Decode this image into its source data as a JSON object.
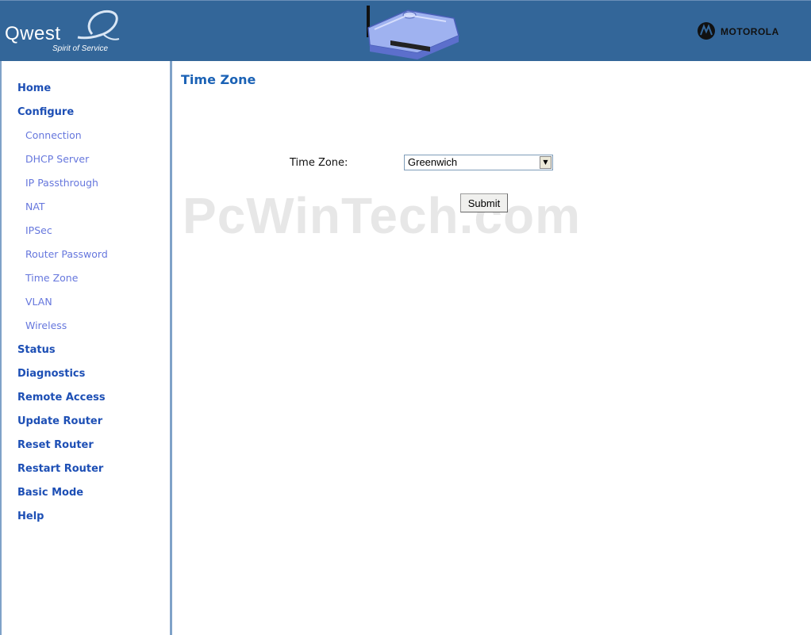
{
  "header": {
    "brand": "Qwest",
    "tagline": "Spirit of Service",
    "vendor": "MOTOROLA"
  },
  "sidebar": {
    "items": [
      {
        "label": "Home",
        "level": "main"
      },
      {
        "label": "Configure",
        "level": "main"
      },
      {
        "label": "Connection",
        "level": "sub"
      },
      {
        "label": "DHCP Server",
        "level": "sub"
      },
      {
        "label": "IP Passthrough",
        "level": "sub"
      },
      {
        "label": "NAT",
        "level": "sub"
      },
      {
        "label": "IPSec",
        "level": "sub"
      },
      {
        "label": "Router Password",
        "level": "sub"
      },
      {
        "label": "Time Zone",
        "level": "sub"
      },
      {
        "label": "VLAN",
        "level": "sub"
      },
      {
        "label": "Wireless",
        "level": "sub"
      },
      {
        "label": "Status",
        "level": "main"
      },
      {
        "label": "Diagnostics",
        "level": "main"
      },
      {
        "label": "Remote Access",
        "level": "main"
      },
      {
        "label": "Update Router",
        "level": "main"
      },
      {
        "label": "Reset Router",
        "level": "main"
      },
      {
        "label": "Restart Router",
        "level": "main"
      },
      {
        "label": "Basic Mode",
        "level": "main"
      },
      {
        "label": "Help",
        "level": "main"
      }
    ]
  },
  "main": {
    "title": "Time Zone",
    "watermark": "PcWinTech.com",
    "form": {
      "timezone_label": "Time Zone:",
      "timezone_value": "Greenwich",
      "submit_label": "Submit"
    }
  },
  "colors": {
    "header_bg": "#336699",
    "nav_main": "#1d4fb5",
    "nav_sub": "#6677dd",
    "title": "#1b62b5"
  }
}
